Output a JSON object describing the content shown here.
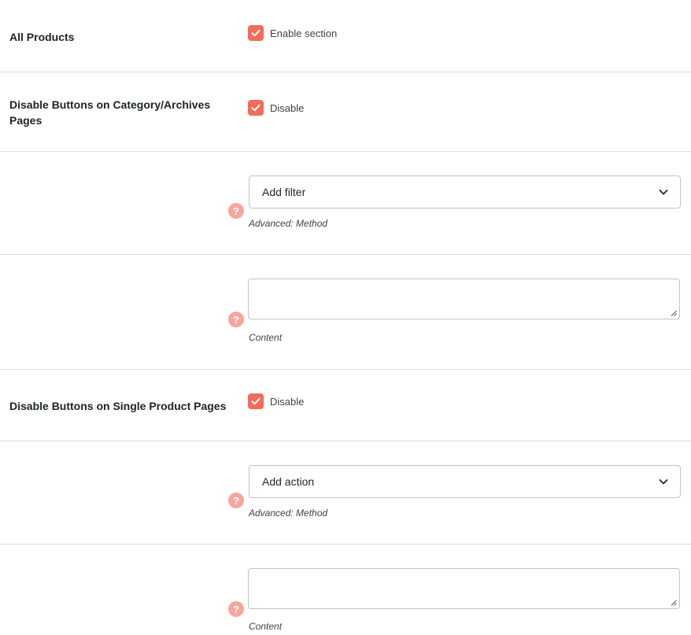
{
  "sections": {
    "all_products": {
      "label": "All Products",
      "checkbox_label": "Enable section",
      "checked": true
    },
    "category_archives": {
      "label": "Disable Buttons on Category/Archives Pages",
      "checkbox_label": "Disable",
      "checked": true
    },
    "category_method": {
      "select_value": "Add filter",
      "description": "Advanced: Method"
    },
    "category_content": {
      "value": "",
      "description": "Content"
    },
    "single_product": {
      "label": "Disable Buttons on Single Product Pages",
      "checkbox_label": "Disable",
      "checked": true
    },
    "single_method": {
      "select_value": "Add action",
      "description": "Advanced: Method"
    },
    "single_content": {
      "value": "",
      "description": "Content"
    }
  },
  "help_icon_text": "?",
  "colors": {
    "accent": "#f26c5b",
    "help": "#f6a69c",
    "border": "#c3c4c7",
    "divider": "#dcdcde"
  },
  "icons": {
    "checkbox": "checkmark-icon",
    "select": "chevron-down-icon",
    "help": "help-icon",
    "textarea": "resize-grip-icon"
  }
}
